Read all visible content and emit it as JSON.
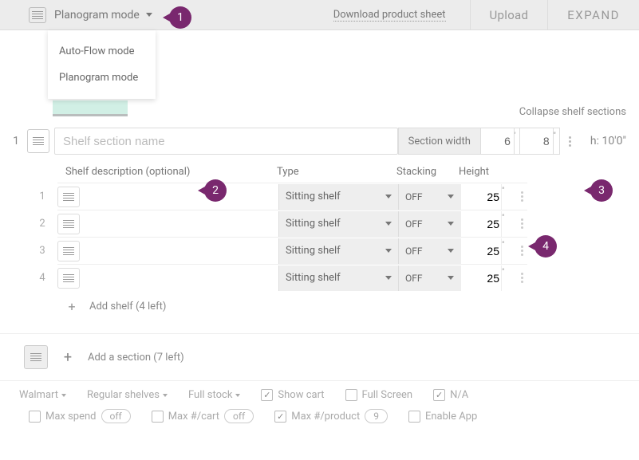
{
  "toolbar": {
    "mode_label": "Planogram mode",
    "download_label": "Download product sheet",
    "upload_label": "Upload",
    "expand_label": "EXPAND",
    "dropdown": [
      "Auto-Flow mode",
      "Planogram mode"
    ]
  },
  "markers": {
    "m1": "1",
    "m2": "2",
    "m3": "3",
    "m4": "4"
  },
  "collapse_label": "Collapse shelf sections",
  "section": {
    "num": "1",
    "name_placeholder": "Shelf section name",
    "width_label": "Section width",
    "width_ft": "6",
    "width_in": "8",
    "ft_unit": "'",
    "in_unit": "\"",
    "height_display": "h: 10'0\""
  },
  "table": {
    "headers": {
      "desc": "Shelf description (optional)",
      "type": "Type",
      "stack": "Stacking",
      "height": "Height"
    },
    "rows": [
      {
        "n": "1",
        "type": "Sitting shelf",
        "stack": "OFF",
        "height": "25"
      },
      {
        "n": "2",
        "type": "Sitting shelf",
        "stack": "OFF",
        "height": "25"
      },
      {
        "n": "3",
        "type": "Sitting shelf",
        "stack": "OFF",
        "height": "25"
      },
      {
        "n": "4",
        "type": "Sitting shelf",
        "stack": "OFF",
        "height": "25"
      }
    ],
    "add_shelf": "Add shelf (4 left)"
  },
  "add_section_label": "Add a section (7 left)",
  "filters": {
    "retailer": "Walmart",
    "shelf_type": "Regular shelves",
    "stock": "Full stock",
    "show_cart": "Show cart",
    "full_screen": "Full Screen",
    "na": "N/A",
    "max_spend": "Max spend",
    "max_spend_val": "off",
    "max_cart": "Max #/cart",
    "max_cart_val": "off",
    "max_product": "Max #/product",
    "max_product_val": "9",
    "enable_app": "Enable App"
  }
}
